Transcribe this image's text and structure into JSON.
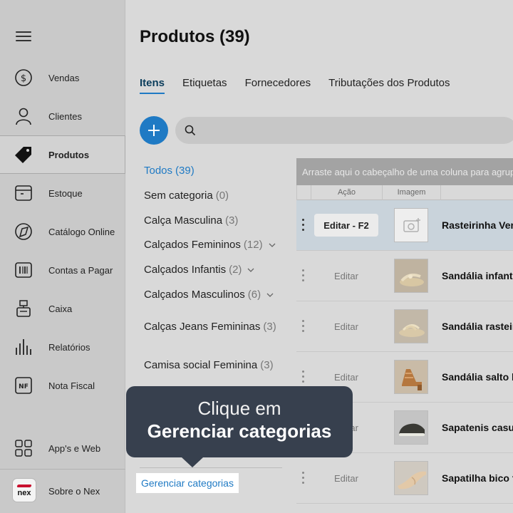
{
  "sidebar": {
    "items": [
      {
        "label": "Vendas",
        "icon": "dollar-circle-icon"
      },
      {
        "label": "Clientes",
        "icon": "user-icon"
      },
      {
        "label": "Produtos",
        "icon": "tag-icon",
        "active": true
      },
      {
        "label": "Estoque",
        "icon": "box-icon"
      },
      {
        "label": "Catálogo Online",
        "icon": "catalog-icon"
      },
      {
        "label": "Contas a Pagar",
        "icon": "barcode-icon"
      },
      {
        "label": "Caixa",
        "icon": "cash-register-icon"
      },
      {
        "label": "Relatórios",
        "icon": "bar-chart-icon"
      },
      {
        "label": "Nota Fiscal",
        "icon": "nf-icon"
      }
    ],
    "apps": {
      "label": "App's e Web",
      "icon": "apps-grid-icon"
    },
    "about": {
      "label": "Sobre o Nex",
      "logo_text": "nex"
    }
  },
  "header": {
    "title": "Produtos (39)"
  },
  "tabs": [
    {
      "label": "Itens",
      "active": true
    },
    {
      "label": "Etiquetas"
    },
    {
      "label": "Fornecedores"
    },
    {
      "label": "Tributações dos Produtos"
    }
  ],
  "search": {
    "value": ""
  },
  "categories": [
    {
      "name": "Todos",
      "count": "(39)",
      "active": true
    },
    {
      "name": "Sem categoria",
      "count": "(0)"
    },
    {
      "name": "Calça Masculina",
      "count": "(3)"
    },
    {
      "name": "Calçados Femininos",
      "count": "(12)",
      "expandable": true
    },
    {
      "name": "Calçados Infantis",
      "count": "(2)",
      "expandable": true
    },
    {
      "name": "Calçados Masculinos",
      "count": "(6)",
      "expandable": true
    },
    {
      "name": "Calças Jeans Femininas",
      "count": "(3)"
    },
    {
      "name": "Camisa social Feminina",
      "count": "(3)"
    }
  ],
  "manage_categories": "Gerenciar categorias",
  "grid": {
    "group_hint": "Arraste aqui o cabeçalho de uma coluna para agrupar",
    "columns": [
      "Ação",
      "Imagem"
    ],
    "rows": [
      {
        "edit": "Editar - F2",
        "name": "Rasteirinha Verniz",
        "selected": true
      },
      {
        "edit": "Editar",
        "name": "Sandália infantil"
      },
      {
        "edit": "Editar",
        "name": "Sandália rasteira"
      },
      {
        "edit": "Editar",
        "name": "Sandália salto bloco"
      },
      {
        "edit": "Editar",
        "name": "Sapatenis casual"
      },
      {
        "edit": "Editar",
        "name": "Sapatilha bico fino"
      }
    ]
  },
  "tooltip": {
    "line1": "Clique em",
    "line2": "Gerenciar categorias"
  },
  "colors": {
    "accent": "#1f7ac4",
    "tooltip_bg": "#37404e",
    "brand_red": "#c8102e"
  }
}
